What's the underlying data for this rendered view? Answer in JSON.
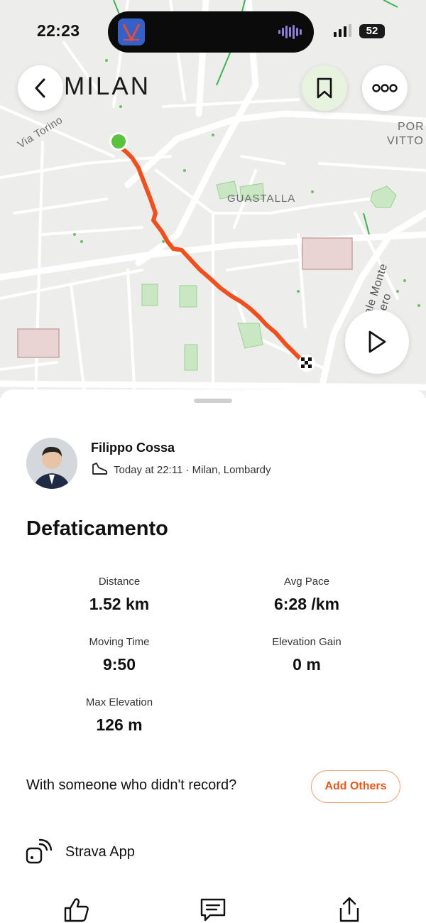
{
  "status_bar": {
    "time": "22:23",
    "battery": "52"
  },
  "map": {
    "title": "MILAN",
    "labels": {
      "via_torino": "Via Torino",
      "guastalla": "GUASTALLA",
      "monte_nero": "ale Monte Nero",
      "porta_vittoria_1": "POR",
      "porta_vittoria_2": "VITTO"
    },
    "route_color": "#f0501e",
    "start_marker_color": "#5cc23e"
  },
  "activity": {
    "athlete_name": "Filippo Cossa",
    "timestamp_location": "Today at 22:11 · Milan, Lombardy",
    "title": "Defaticamento",
    "stats": [
      {
        "label": "Distance",
        "value": "1.52 km"
      },
      {
        "label": "Avg Pace",
        "value": "6:28 /km"
      },
      {
        "label": "Moving Time",
        "value": "9:50"
      },
      {
        "label": "Elevation Gain",
        "value": "0 m"
      },
      {
        "label": "Max Elevation",
        "value": "126 m"
      }
    ]
  },
  "with_others": {
    "prompt": "With someone who didn't record?",
    "button": "Add Others"
  },
  "device": {
    "label": "Strava App"
  },
  "actions": [
    "thumbs-up-icon",
    "comment-icon",
    "share-icon"
  ],
  "colors": {
    "accent": "#f0501e",
    "button_text": "#e8571c"
  }
}
